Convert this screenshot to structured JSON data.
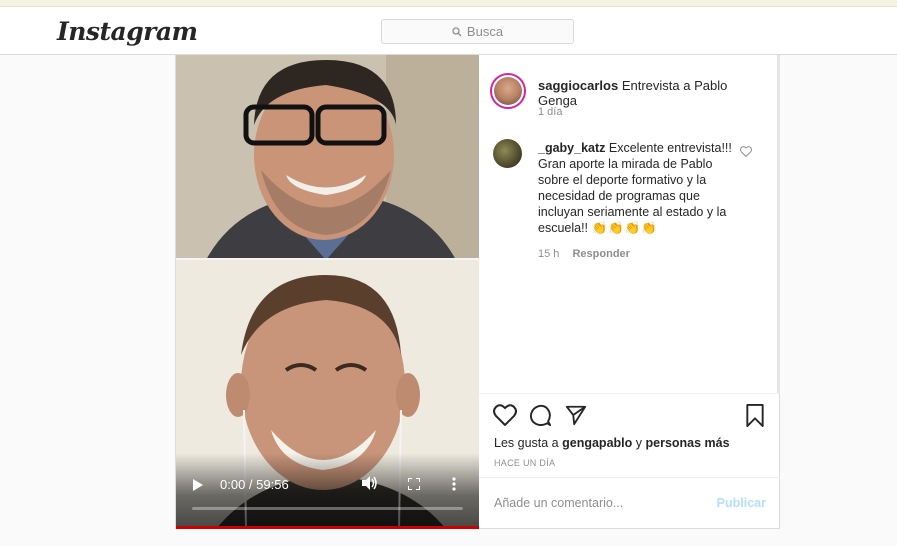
{
  "nav": {
    "logo": "Instagram",
    "search_placeholder": "Busca"
  },
  "post": {
    "author": "saggiocarlos",
    "caption": "Entrevista a Pablo Genga",
    "caption_time": "1 día",
    "comment": {
      "user": "_gaby_katz",
      "text": "Excelente entrevista!!! Gran aporte la mirada de Pablo sobre el deporte formativo y la necesidad de programas que incluyan seriamente al estado y la escuela!!",
      "emojis": "👏👏👏👏",
      "time": "15 h",
      "reply_label": "Responder"
    },
    "likes": {
      "prefix": "Les gusta a",
      "user": "gengapablo",
      "joiner": "y",
      "others": "personas más"
    },
    "ago": "HACE UN DÍA",
    "comment_placeholder": "Añade un comentario...",
    "publish_label": "Publicar"
  },
  "video": {
    "time_display": "0:00 / 59:56",
    "progress_fraction": 0.0
  },
  "colors": {
    "story_ring": "#d6249f",
    "publish_disabled": "#b2dffc"
  }
}
